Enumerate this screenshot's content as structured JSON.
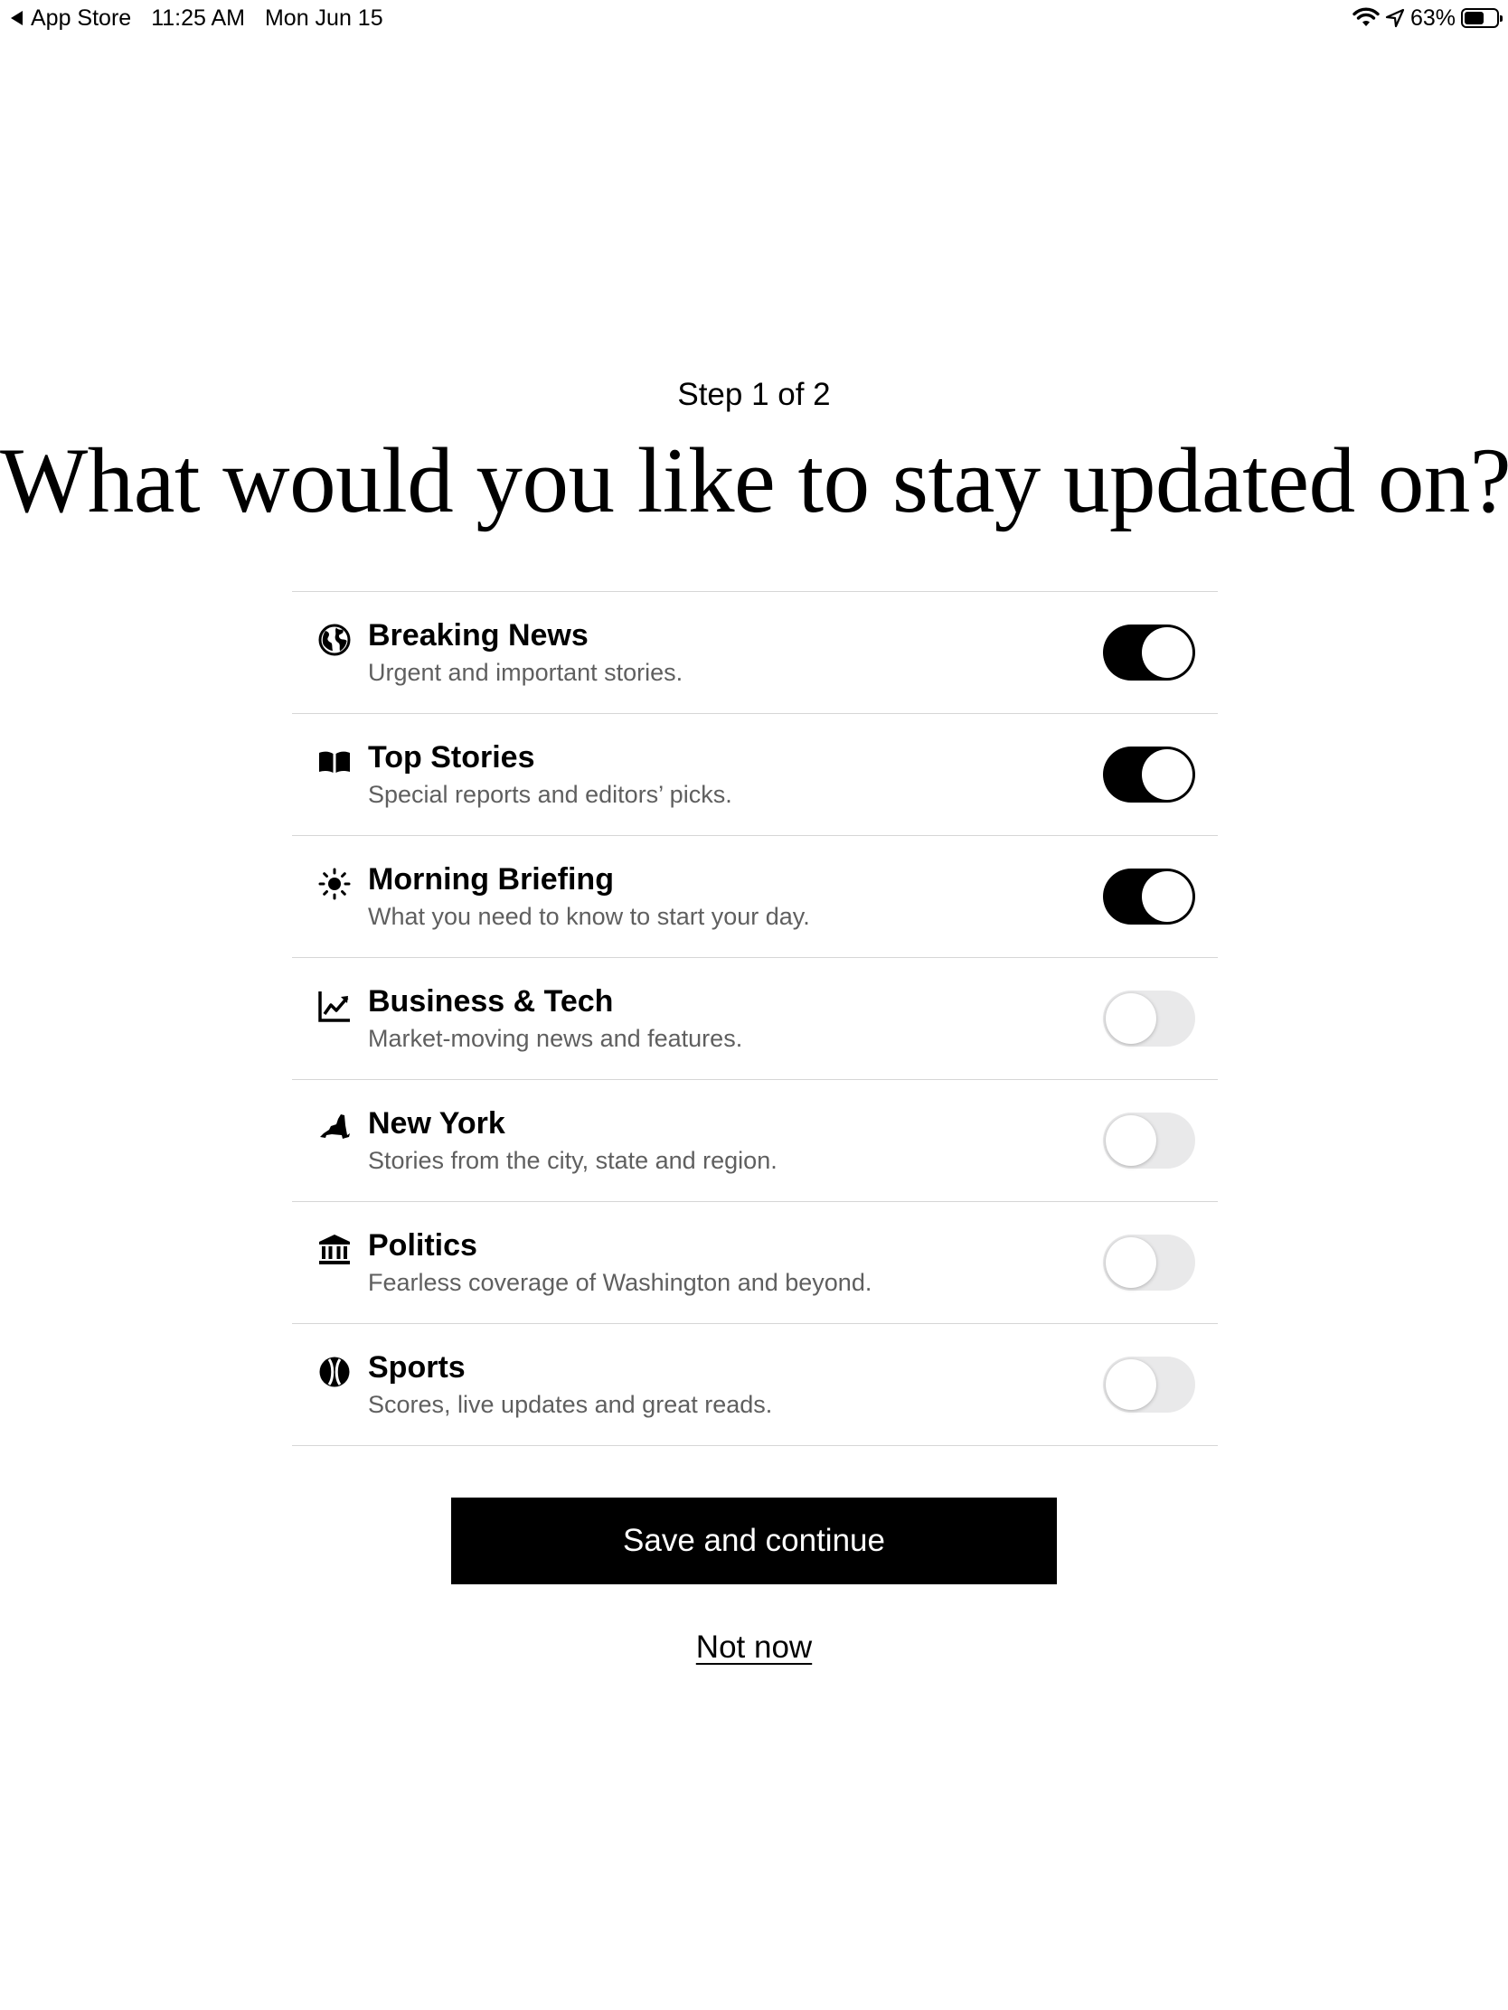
{
  "status_bar": {
    "back_app": "App Store",
    "time": "11:25 AM",
    "date": "Mon Jun 15",
    "battery_percent": "63%",
    "battery_level": 0.63,
    "icons": [
      "wifi-icon",
      "location-icon",
      "battery-icon"
    ]
  },
  "header": {
    "step": "Step 1 of 2",
    "title": "What would you like to stay updated on?"
  },
  "topics": [
    {
      "icon": "globe-icon",
      "title": "Breaking News",
      "description": "Urgent and important stories.",
      "enabled": true
    },
    {
      "icon": "book-icon",
      "title": "Top Stories",
      "description": "Special reports and editors’ picks.",
      "enabled": true
    },
    {
      "icon": "sun-icon",
      "title": "Morning Briefing",
      "description": "What you need to know to start your day.",
      "enabled": true
    },
    {
      "icon": "chart-icon",
      "title": "Business & Tech",
      "description": "Market-moving news and features.",
      "enabled": false
    },
    {
      "icon": "new-york-state-icon",
      "title": "New York",
      "description": "Stories from the city, state and region.",
      "enabled": false
    },
    {
      "icon": "capitol-icon",
      "title": "Politics",
      "description": "Fearless coverage of Washington and beyond.",
      "enabled": false
    },
    {
      "icon": "baseball-icon",
      "title": "Sports",
      "description": "Scores, live updates and great reads.",
      "enabled": false
    }
  ],
  "actions": {
    "save_label": "Save and continue",
    "not_now_label": "Not now"
  },
  "colors": {
    "toggle_on": "#000000",
    "toggle_off": "#e9e9ea",
    "button_bg": "#000000",
    "description_text": "#5f5f5f",
    "divider": "#d6d6d6"
  }
}
